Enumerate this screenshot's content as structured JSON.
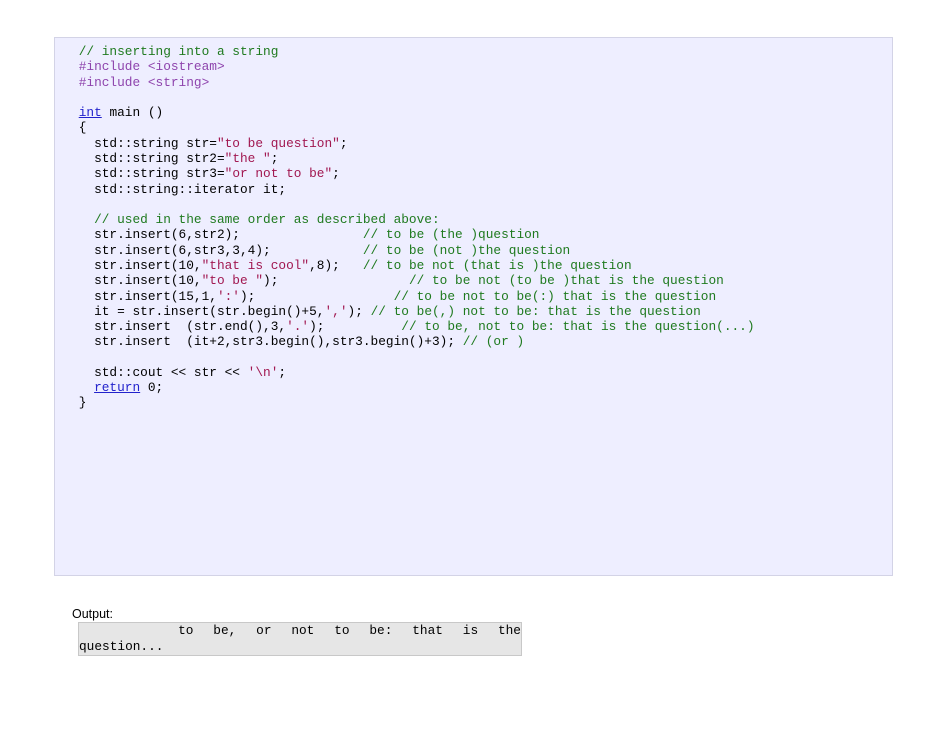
{
  "code_sample": {
    "language": "cpp",
    "lines": [
      [
        {
          "t": "    ",
          "s": "plain"
        },
        {
          "t": "// inserting into a string",
          "s": "com"
        }
      ],
      [
        {
          "t": "    ",
          "s": "plain"
        },
        {
          "t": "#include <iostream>",
          "s": "pre"
        }
      ],
      [
        {
          "t": "    ",
          "s": "plain"
        },
        {
          "t": "#include <string>",
          "s": "pre"
        }
      ],
      [
        {
          "t": "",
          "s": "plain"
        }
      ],
      [
        {
          "t": "    ",
          "s": "plain"
        },
        {
          "t": "int",
          "s": "kw"
        },
        {
          "t": " main ()",
          "s": "plain"
        }
      ],
      [
        {
          "t": "    {",
          "s": "plain"
        }
      ],
      [
        {
          "t": "      std::string str=",
          "s": "plain"
        },
        {
          "t": "\"to be question\"",
          "s": "str"
        },
        {
          "t": ";",
          "s": "plain"
        }
      ],
      [
        {
          "t": "      std::string str2=",
          "s": "plain"
        },
        {
          "t": "\"the \"",
          "s": "str"
        },
        {
          "t": ";",
          "s": "plain"
        }
      ],
      [
        {
          "t": "      std::string str3=",
          "s": "plain"
        },
        {
          "t": "\"or not to be\"",
          "s": "str"
        },
        {
          "t": ";",
          "s": "plain"
        }
      ],
      [
        {
          "t": "      std::string::iterator it;",
          "s": "plain"
        }
      ],
      [
        {
          "t": "",
          "s": "plain"
        }
      ],
      [
        {
          "t": "      ",
          "s": "plain"
        },
        {
          "t": "// used in the same order as described above:",
          "s": "com"
        }
      ],
      [
        {
          "t": "      str.insert(6,str2);                ",
          "s": "plain"
        },
        {
          "t": "// to be (the )question",
          "s": "com"
        }
      ],
      [
        {
          "t": "      str.insert(6,str3,3,4);            ",
          "s": "plain"
        },
        {
          "t": "// to be (not )the question",
          "s": "com"
        }
      ],
      [
        {
          "t": "      str.insert(10,",
          "s": "plain"
        },
        {
          "t": "\"that is cool\"",
          "s": "str"
        },
        {
          "t": ",8);   ",
          "s": "plain"
        },
        {
          "t": "// to be not (that is )the question",
          "s": "com"
        }
      ],
      [
        {
          "t": "      str.insert(10,",
          "s": "plain"
        },
        {
          "t": "\"to be \"",
          "s": "str"
        },
        {
          "t": ");                 ",
          "s": "plain"
        },
        {
          "t": "// to be not (to be )that is the question",
          "s": "com"
        }
      ],
      [
        {
          "t": "      str.insert(15,1,",
          "s": "plain"
        },
        {
          "t": "':'",
          "s": "str"
        },
        {
          "t": ");                  ",
          "s": "plain"
        },
        {
          "t": "// to be not to be(:) that is the question",
          "s": "com"
        }
      ],
      [
        {
          "t": "      it = str.insert(str.begin()+5,",
          "s": "plain"
        },
        {
          "t": "','",
          "s": "str"
        },
        {
          "t": "); ",
          "s": "plain"
        },
        {
          "t": "// to be(,) not to be: that is the question",
          "s": "com"
        }
      ],
      [
        {
          "t": "      str.insert  (str.end(),3,",
          "s": "plain"
        },
        {
          "t": "'.'",
          "s": "str"
        },
        {
          "t": ");          ",
          "s": "plain"
        },
        {
          "t": "// to be, not to be: that is the question(...)",
          "s": "com"
        }
      ],
      [
        {
          "t": "      str.insert  (it+2,str3.begin(),str3.begin()+3); ",
          "s": "plain"
        },
        {
          "t": "// (or )",
          "s": "com"
        }
      ],
      [
        {
          "t": "",
          "s": "plain"
        }
      ],
      [
        {
          "t": "      std::cout << str << ",
          "s": "plain"
        },
        {
          "t": "'\\n'",
          "s": "str"
        },
        {
          "t": ";",
          "s": "plain"
        }
      ],
      [
        {
          "t": "      ",
          "s": "plain"
        },
        {
          "t": "return",
          "s": "kw"
        },
        {
          "t": " 0;",
          "s": "plain"
        }
      ],
      [
        {
          "t": "    }",
          "s": "plain"
        }
      ]
    ]
  },
  "output": {
    "label": "Output:",
    "line1": "     to be, or not to be: that is the",
    "line2": "question..."
  },
  "colors": {
    "code_background": "#EEEEFF",
    "code_border": "#D3D3E6",
    "output_background": "#E6E6E6",
    "output_border": "#C8C8C8",
    "comment": "#1F7A1F",
    "preprocessor": "#8E44AD",
    "string_literal": "#A11750",
    "keyword": "#2222CC",
    "page_background": "#FFFFFF"
  }
}
